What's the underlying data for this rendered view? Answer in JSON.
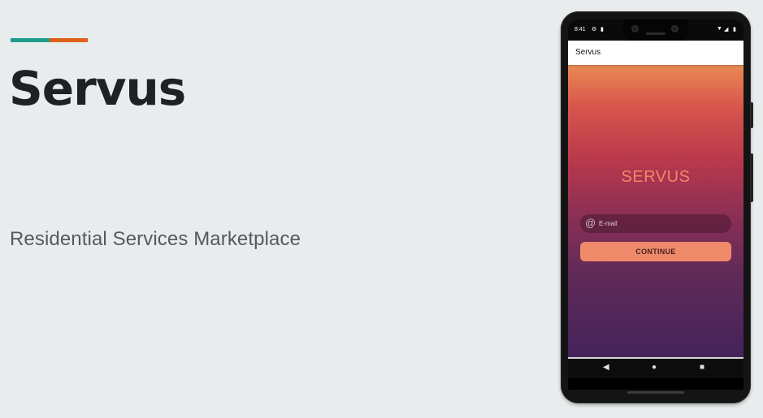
{
  "colors": {
    "background": "#e8ecec",
    "accent_teal": "#1f9d8b",
    "accent_orange": "#e0601b",
    "logo": "#f2856b",
    "button": "#ee8a6a"
  },
  "slide": {
    "title": "Servus",
    "subtitle": "Residential Services Marketplace"
  },
  "phone": {
    "status_bar": {
      "time": "8:41",
      "icons": [
        "gear-icon",
        "sd-card-icon",
        "wifi-icon",
        "signal-icon",
        "battery-icon"
      ]
    },
    "app_bar": {
      "title": "Servus"
    },
    "app": {
      "logo_text": "SERVUS",
      "email_placeholder": "E-mail",
      "email_icon": "at-icon",
      "continue_label": "CONTINUE"
    },
    "nav_bar": {
      "icons": [
        "back-icon",
        "home-icon",
        "recents-icon"
      ]
    }
  }
}
